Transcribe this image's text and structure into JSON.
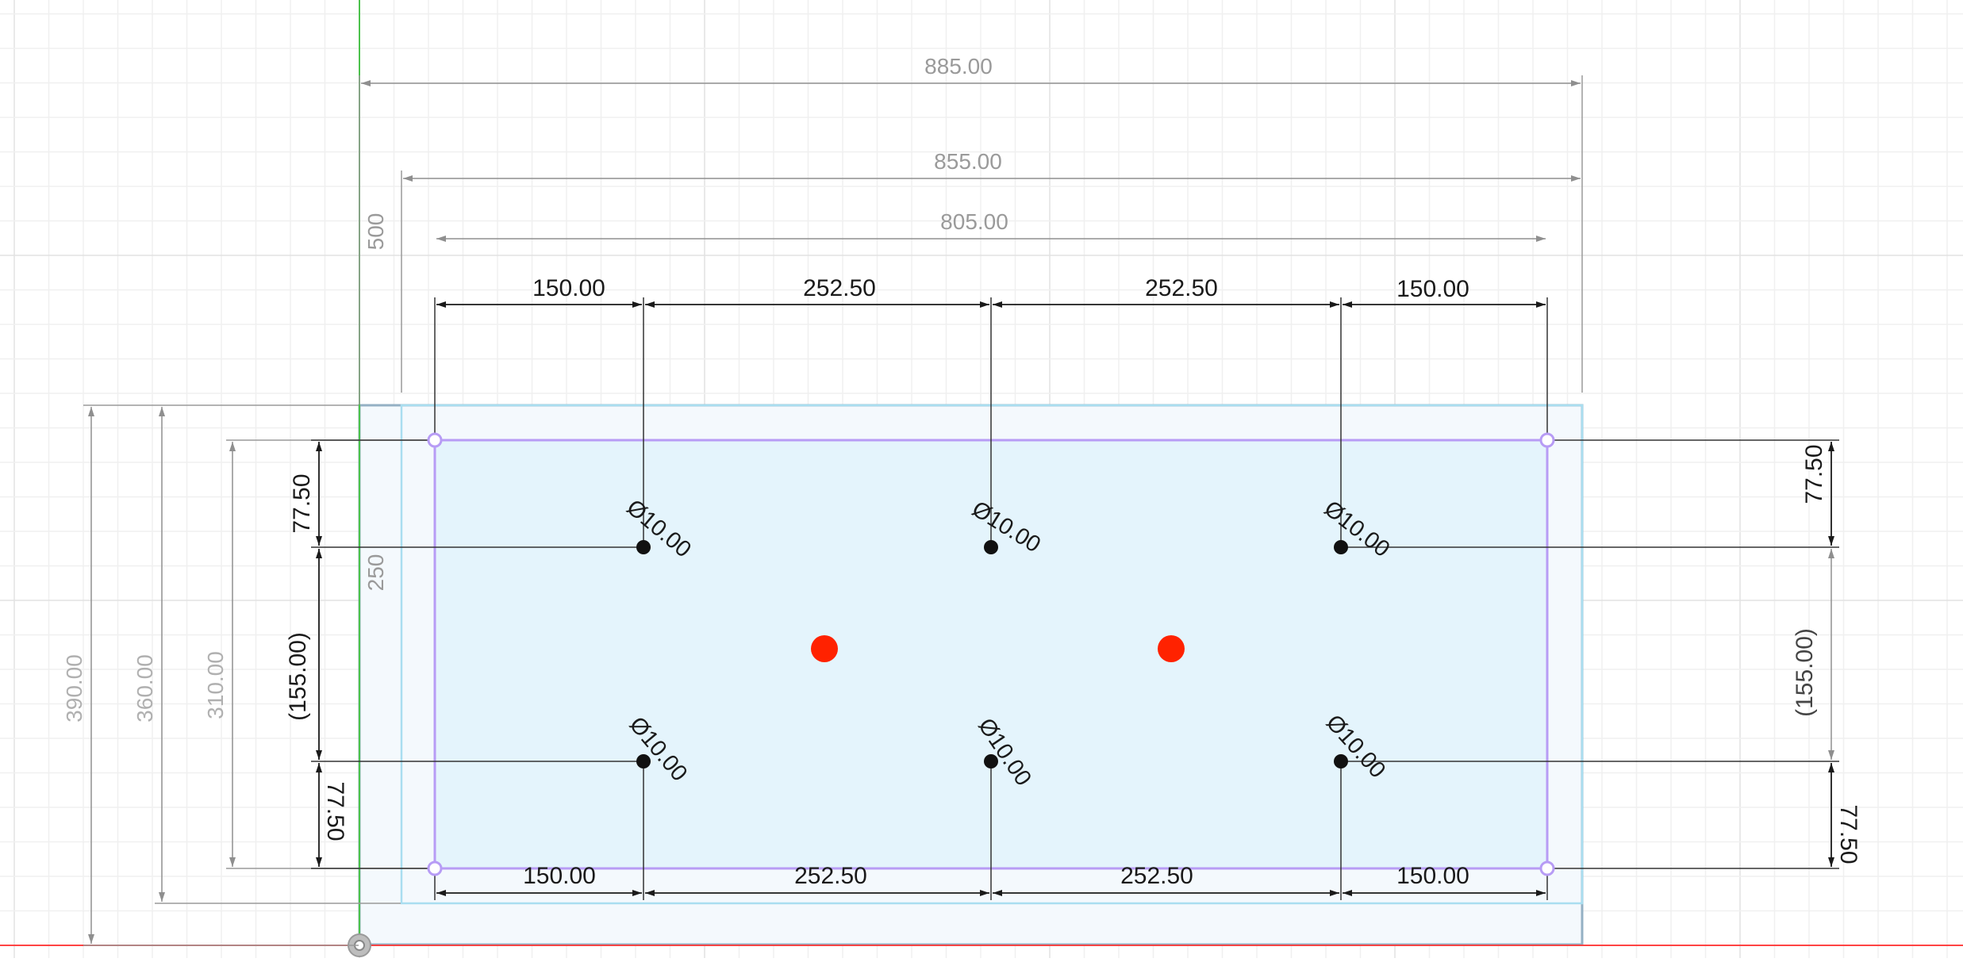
{
  "sketch": {
    "overall_width": "885.00",
    "offset_width": "855.00",
    "inner_width": "805.00",
    "label_500": "500",
    "label_250": "250",
    "top_spacings": [
      "150.00",
      "252.50",
      "252.50",
      "150.00"
    ],
    "bottom_spacings": [
      "150.00",
      "252.50",
      "252.50",
      "150.00"
    ],
    "left_heights": {
      "h390": "390.00",
      "h360": "360.00",
      "h310": "310.00"
    },
    "left_chain": {
      "top": "77.50",
      "middle": "(155.00)",
      "bottom": "77.50"
    },
    "right_chain": {
      "top": "77.50",
      "middle": "(155.00)",
      "bottom": "77.50"
    },
    "hole_label": "Ø10.00",
    "hole_count": 6,
    "red_point_count": 2
  },
  "colors": {
    "grid_minor": "#f0f0f0",
    "grid_major": "#e2e2e2",
    "panel_fill": "#f4f9fd",
    "panel_border": "#94b0c4",
    "inner_fill": "#e4f4fc",
    "offset_rect": "#a9def0",
    "construction": "#b79cf5",
    "dim_dark": "#1a1a1a",
    "dim_light": "#8f8f8f",
    "axis_x": "#ff4444",
    "axis_y": "#4cc24c",
    "point_red": "#ff2200"
  }
}
